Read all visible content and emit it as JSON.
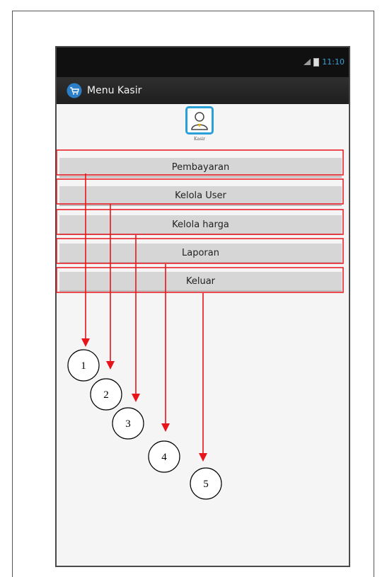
{
  "status_bar": {
    "time": "11:10",
    "time_color": "#36a3d9"
  },
  "action_bar": {
    "title": "Menu Kasir",
    "icon": "cart-icon"
  },
  "logo": {
    "label": "Kasir",
    "accent": "#2aa0d8"
  },
  "menu": {
    "items": [
      {
        "label": "Pembayaran"
      },
      {
        "label": "Kelola User"
      },
      {
        "label": "Kelola harga"
      },
      {
        "label": "Laporan"
      },
      {
        "label": "Keluar"
      }
    ]
  },
  "callouts": [
    "1",
    "2",
    "3",
    "4",
    "5"
  ],
  "highlight_color": "#e8141b"
}
